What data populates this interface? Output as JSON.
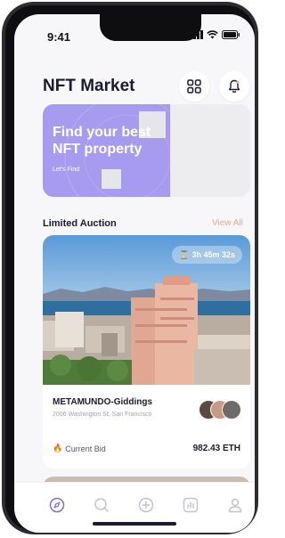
{
  "status_bar": {
    "time": "9:41"
  },
  "header": {
    "title": "NFT Market",
    "grid_icon": "grid-icon",
    "bell_icon": "bell-icon"
  },
  "banner": {
    "title": "Find your best NFT property",
    "subtitle": "Let's Find"
  },
  "section": {
    "title": "Limited Auction",
    "view_all": "View All"
  },
  "auction_card": {
    "timer": "3h 45m 32s",
    "name": "METAMUNDO-Giddings",
    "address": "2006 Washington St, San Francisco",
    "bid_label": "Current Bid",
    "bid_value": "982.43 ETH"
  },
  "tabs": [
    "compass-icon",
    "search-icon",
    "plus-circle-icon",
    "chart-icon",
    "user-icon"
  ],
  "colors": {
    "accent": "#a79bf0",
    "active_tab": "#7b6ee8",
    "view_all": "#f0a58c",
    "text_dark": "#1b1b2e"
  }
}
